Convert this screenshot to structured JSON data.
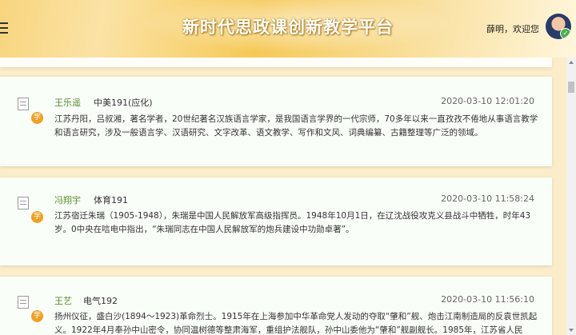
{
  "header": {
    "title": "新时代思政课创新教学平台",
    "welcome": "薛明，欢迎您"
  },
  "posts": [
    {
      "name": "王乐遥",
      "class": "中美191(应化)",
      "time": "2020-03-10 12:01:20",
      "badge": "学",
      "text": "江苏丹阳，吕叔湘，著名学者，20世纪著名汉族语言学家，是我国语言学界的一代宗师，70多年以来一直孜孜不倦地从事语言教学和语言研究，涉及一般语言学、汉语研究、文字改革、语文教学、写作和文风、词典编纂、古籍整理等广泛的领域。"
    },
    {
      "name": "冯翔宇",
      "class": "体育191",
      "time": "2020-03-10 11:58:24",
      "badge": "学",
      "text": "江苏宿迁朱瑞（1905-1948），朱瑞是中国人民解放军高级指挥员。1948年10月1日，在辽沈战役攻克义县战斗中牺牲，时年43岁。0中央在唁电中指出，“朱瑞同志在中国人民解放军的炮兵建设中功勋卓著”。"
    },
    {
      "name": "王艺",
      "class": "电气192",
      "time": "2020-03-10 11:56:10",
      "badge": "学",
      "text": "扬州仪征，盛白沙(1894～1923)革命烈士。1915年在上海参加中华革命党人发动的夺取“肇和”舰、炮击江南制造局的反袁世凯起义。1922年4月奉孙中山密令，协同温树德等整肃海军，重组护法舰队，孙中山委他为“肇和”舰副舰长。1985年，江苏省人民"
    }
  ]
}
